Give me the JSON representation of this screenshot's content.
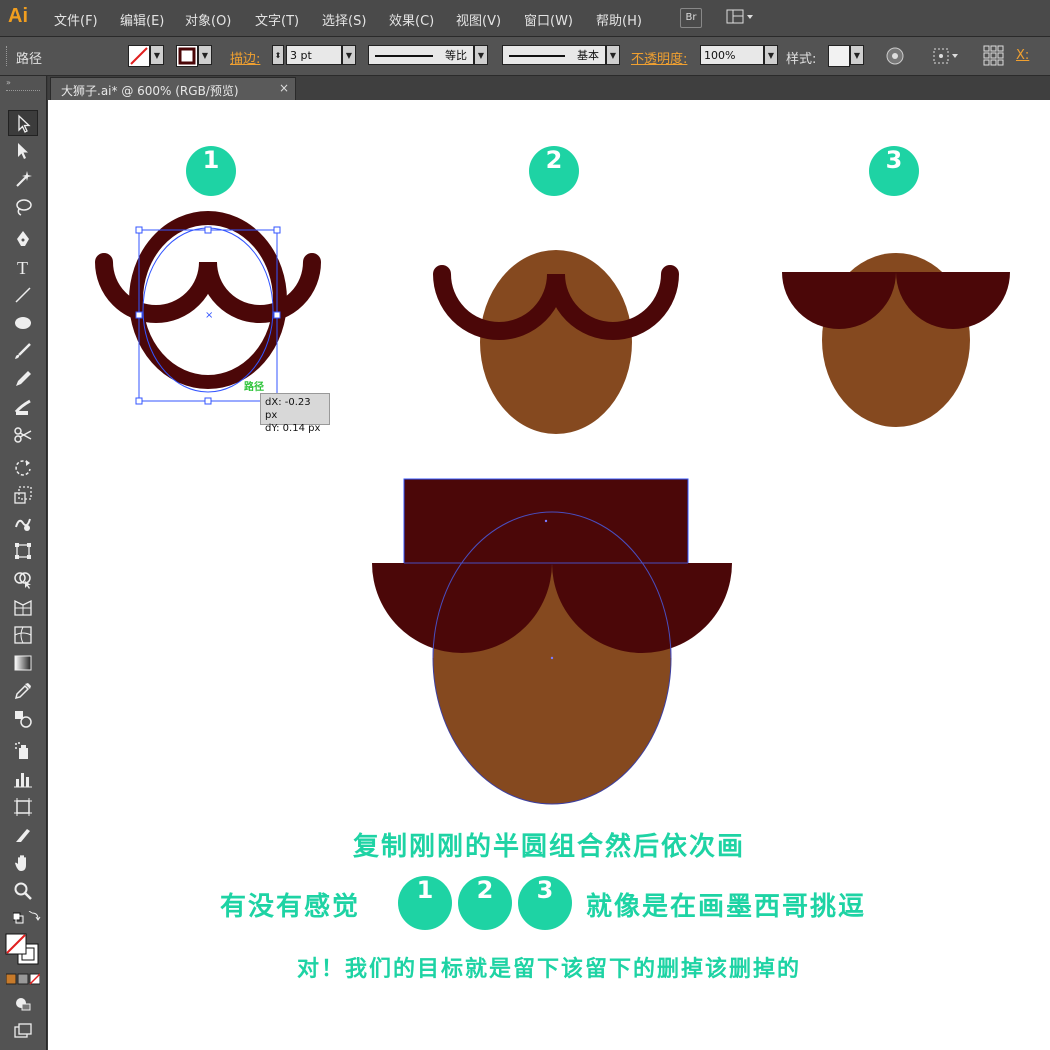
{
  "app": {
    "logo": "Ai"
  },
  "menu": [
    "文件(F)",
    "编辑(E)",
    "对象(O)",
    "文字(T)",
    "选择(S)",
    "效果(C)",
    "视图(V)",
    "窗口(W)",
    "帮助(H)"
  ],
  "menu_extra": {
    "bridge_label": "Br"
  },
  "control": {
    "path_label": "路径",
    "stroke_label": "描边:",
    "stroke_value": "3 pt",
    "stroke_profile": "等比",
    "brush_label": "基本",
    "opacity_label": "不透明度:",
    "opacity_value": "100%",
    "style_label": "样式:",
    "x_label": "X:"
  },
  "document": {
    "tab_title": "大狮子.ai* @ 600% (RGB/预览)",
    "close_glyph": "×"
  },
  "colors": {
    "accent": "#1ed3a4",
    "mustache": "#4b0708",
    "face": "#85491f",
    "selection": "#3355ff"
  },
  "steps": [
    {
      "label": "1"
    },
    {
      "label": "2"
    },
    {
      "label": "3"
    }
  ],
  "tooltip": {
    "dx": "dX: -0.23 px",
    "dy": "dY: 0.14 px",
    "anchor_label": "路径"
  },
  "captions": {
    "line1": "复制刚刚的半圆组合然后依次画",
    "line2_left": "有没有感觉",
    "line2_right": "就像是在画墨西哥挑逗",
    "line3": "对！我们的目标就是留下该留下的删掉该删掉的"
  },
  "inline_steps": [
    "1",
    "2",
    "3"
  ]
}
